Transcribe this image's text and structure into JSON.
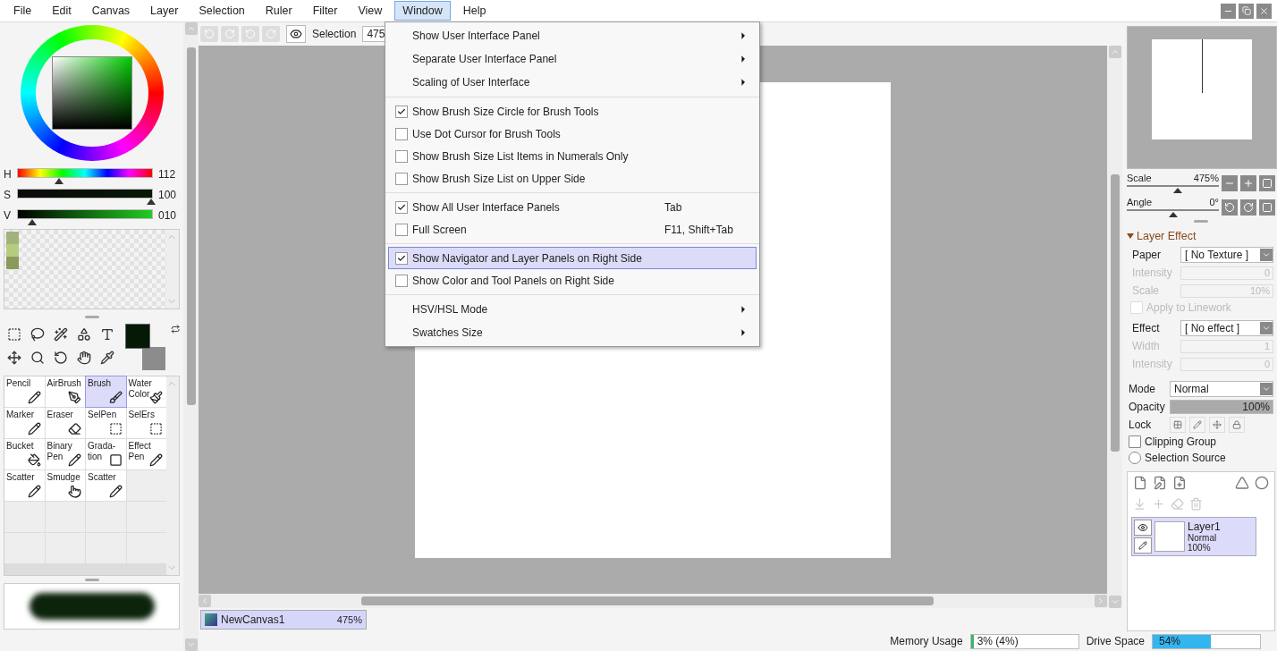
{
  "menubar": [
    {
      "label": "File",
      "selected": false
    },
    {
      "label": "Edit",
      "selected": false
    },
    {
      "label": "Canvas",
      "selected": false
    },
    {
      "label": "Layer",
      "selected": false
    },
    {
      "label": "Selection",
      "selected": false
    },
    {
      "label": "Ruler",
      "selected": false
    },
    {
      "label": "Filter",
      "selected": false
    },
    {
      "label": "View",
      "selected": false
    },
    {
      "label": "Window",
      "selected": true
    },
    {
      "label": "Help",
      "selected": false
    }
  ],
  "color_sliders": [
    {
      "name": "H",
      "value": "112",
      "level": 0.31
    },
    {
      "name": "S",
      "value": "100",
      "level": 0.99
    },
    {
      "name": "V",
      "value": "010",
      "level": 0.11
    }
  ],
  "swatches": [
    {
      "color": "#a3b27a"
    },
    {
      "color": "#b5cc80"
    },
    {
      "color": "#8a9a5a"
    }
  ],
  "brush_tools": [
    {
      "label": "Pencil",
      "selected": false
    },
    {
      "label": "AirBrush",
      "selected": false
    },
    {
      "label": "Brush",
      "selected": true
    },
    {
      "label": "Water\nColor",
      "selected": false
    },
    {
      "label": "Marker",
      "selected": false
    },
    {
      "label": "Eraser",
      "selected": false
    },
    {
      "label": "SelPen",
      "selected": false
    },
    {
      "label": "SelErs",
      "selected": false
    },
    {
      "label": "Bucket",
      "selected": false
    },
    {
      "label": "Binary\nPen",
      "selected": false
    },
    {
      "label": "Grada-\ntion",
      "selected": false
    },
    {
      "label": "Effect\nPen",
      "selected": false
    },
    {
      "label": "Scatter",
      "selected": false
    },
    {
      "label": "Smudge",
      "selected": false
    },
    {
      "label": "Scatter",
      "selected": false
    }
  ],
  "toolbar": {
    "selection_label": "Selection",
    "zoom": "475"
  },
  "canvas_tab": {
    "name": "NewCanvas1",
    "zoom": "475%",
    "selected": true
  },
  "window_menu": [
    {
      "kind": "submenu",
      "label": "Show User Interface Panel",
      "selected": false
    },
    {
      "kind": "submenu",
      "label": "Separate User Interface Panel",
      "selected": false
    },
    {
      "kind": "submenu",
      "label": "Scaling of User Interface",
      "selected": false
    },
    {
      "kind": "separator"
    },
    {
      "kind": "check",
      "label": "Show Brush Size Circle for Brush Tools",
      "checked": true,
      "selected": false
    },
    {
      "kind": "check",
      "label": "Use Dot Cursor for Brush Tools",
      "checked": false,
      "selected": false
    },
    {
      "kind": "check",
      "label": "Show Brush Size List Items in Numerals Only",
      "checked": false,
      "selected": false
    },
    {
      "kind": "check",
      "label": "Show Brush Size List on Upper Side",
      "checked": false,
      "selected": false
    },
    {
      "kind": "separator"
    },
    {
      "kind": "check",
      "label": "Show All User Interface Panels",
      "checked": true,
      "shortcut": "Tab",
      "selected": false
    },
    {
      "kind": "check",
      "label": "Full Screen",
      "checked": false,
      "shortcut": "F11, Shift+Tab",
      "selected": false
    },
    {
      "kind": "separator"
    },
    {
      "kind": "check",
      "label": "Show Navigator and Layer Panels on Right Side",
      "checked": true,
      "selected": true
    },
    {
      "kind": "check",
      "label": "Show Color and Tool Panels on Right Side",
      "checked": false,
      "selected": false
    },
    {
      "kind": "separator"
    },
    {
      "kind": "submenu",
      "label": "HSV/HSL Mode",
      "selected": false
    },
    {
      "kind": "submenu",
      "label": "Swatches Size",
      "selected": false
    }
  ],
  "navigator": [
    {
      "label": "Scale",
      "value": "475%",
      "level": 0.55
    },
    {
      "label": "Angle",
      "value": "0°",
      "level": 0.5
    }
  ],
  "layer_effect": {
    "title": "Layer Effect",
    "expanded": true,
    "paper": {
      "label": "Paper",
      "value": "[ No Texture ]"
    },
    "paper_fields": [
      {
        "label": "Intensity",
        "value": "0",
        "disabled": true
      },
      {
        "label": "Scale",
        "value": "10%",
        "disabled": true
      }
    ],
    "apply": {
      "label": "Apply to Linework",
      "checked": false,
      "disabled": true
    },
    "effect": {
      "label": "Effect",
      "value": "[ No effect ]"
    },
    "effect_fields": [
      {
        "label": "Width",
        "value": "1",
        "disabled": true
      },
      {
        "label": "Intensity",
        "value": "0",
        "disabled": true
      }
    ]
  },
  "layer_props": {
    "mode": {
      "label": "Mode",
      "value": "Normal"
    },
    "opacity": {
      "label": "Opacity",
      "value": "100%",
      "level": 1
    },
    "lock": {
      "label": "Lock"
    },
    "clipping": {
      "label": "Clipping Group",
      "checked": false
    },
    "selection_source": {
      "label": "Selection Source",
      "checked": false
    }
  },
  "layers": [
    {
      "name": "Layer1",
      "mode": "Normal",
      "opacity": "100%",
      "visible": true,
      "selected": true
    }
  ],
  "status": [
    {
      "label": "Memory Usage",
      "value": "3% (4%)",
      "level": 0.03,
      "color": "#3cb371"
    },
    {
      "label": "Drive Space",
      "value": "54%",
      "level": 0.54,
      "color": "#33b5f0"
    }
  ]
}
